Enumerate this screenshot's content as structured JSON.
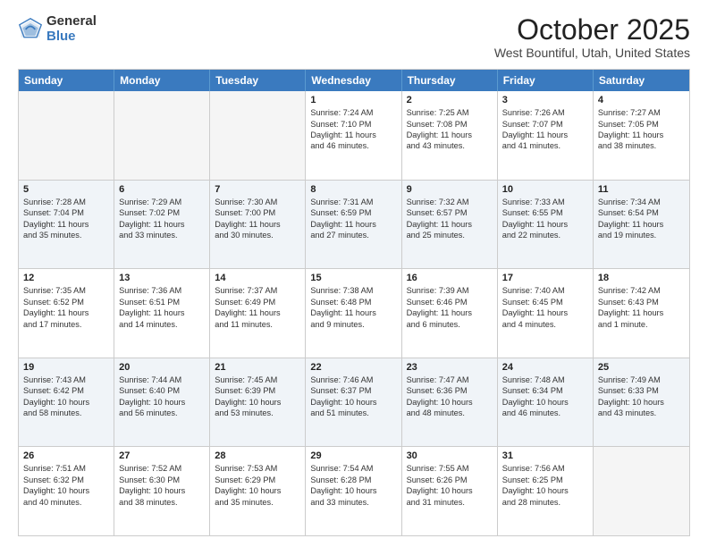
{
  "logo": {
    "general": "General",
    "blue": "Blue"
  },
  "header": {
    "month": "October 2025",
    "location": "West Bountiful, Utah, United States"
  },
  "days_of_week": [
    "Sunday",
    "Monday",
    "Tuesday",
    "Wednesday",
    "Thursday",
    "Friday",
    "Saturday"
  ],
  "weeks": [
    [
      {
        "day": "",
        "info": ""
      },
      {
        "day": "",
        "info": ""
      },
      {
        "day": "",
        "info": ""
      },
      {
        "day": "1",
        "info": "Sunrise: 7:24 AM\nSunset: 7:10 PM\nDaylight: 11 hours\nand 46 minutes."
      },
      {
        "day": "2",
        "info": "Sunrise: 7:25 AM\nSunset: 7:08 PM\nDaylight: 11 hours\nand 43 minutes."
      },
      {
        "day": "3",
        "info": "Sunrise: 7:26 AM\nSunset: 7:07 PM\nDaylight: 11 hours\nand 41 minutes."
      },
      {
        "day": "4",
        "info": "Sunrise: 7:27 AM\nSunset: 7:05 PM\nDaylight: 11 hours\nand 38 minutes."
      }
    ],
    [
      {
        "day": "5",
        "info": "Sunrise: 7:28 AM\nSunset: 7:04 PM\nDaylight: 11 hours\nand 35 minutes."
      },
      {
        "day": "6",
        "info": "Sunrise: 7:29 AM\nSunset: 7:02 PM\nDaylight: 11 hours\nand 33 minutes."
      },
      {
        "day": "7",
        "info": "Sunrise: 7:30 AM\nSunset: 7:00 PM\nDaylight: 11 hours\nand 30 minutes."
      },
      {
        "day": "8",
        "info": "Sunrise: 7:31 AM\nSunset: 6:59 PM\nDaylight: 11 hours\nand 27 minutes."
      },
      {
        "day": "9",
        "info": "Sunrise: 7:32 AM\nSunset: 6:57 PM\nDaylight: 11 hours\nand 25 minutes."
      },
      {
        "day": "10",
        "info": "Sunrise: 7:33 AM\nSunset: 6:55 PM\nDaylight: 11 hours\nand 22 minutes."
      },
      {
        "day": "11",
        "info": "Sunrise: 7:34 AM\nSunset: 6:54 PM\nDaylight: 11 hours\nand 19 minutes."
      }
    ],
    [
      {
        "day": "12",
        "info": "Sunrise: 7:35 AM\nSunset: 6:52 PM\nDaylight: 11 hours\nand 17 minutes."
      },
      {
        "day": "13",
        "info": "Sunrise: 7:36 AM\nSunset: 6:51 PM\nDaylight: 11 hours\nand 14 minutes."
      },
      {
        "day": "14",
        "info": "Sunrise: 7:37 AM\nSunset: 6:49 PM\nDaylight: 11 hours\nand 11 minutes."
      },
      {
        "day": "15",
        "info": "Sunrise: 7:38 AM\nSunset: 6:48 PM\nDaylight: 11 hours\nand 9 minutes."
      },
      {
        "day": "16",
        "info": "Sunrise: 7:39 AM\nSunset: 6:46 PM\nDaylight: 11 hours\nand 6 minutes."
      },
      {
        "day": "17",
        "info": "Sunrise: 7:40 AM\nSunset: 6:45 PM\nDaylight: 11 hours\nand 4 minutes."
      },
      {
        "day": "18",
        "info": "Sunrise: 7:42 AM\nSunset: 6:43 PM\nDaylight: 11 hours\nand 1 minute."
      }
    ],
    [
      {
        "day": "19",
        "info": "Sunrise: 7:43 AM\nSunset: 6:42 PM\nDaylight: 10 hours\nand 58 minutes."
      },
      {
        "day": "20",
        "info": "Sunrise: 7:44 AM\nSunset: 6:40 PM\nDaylight: 10 hours\nand 56 minutes."
      },
      {
        "day": "21",
        "info": "Sunrise: 7:45 AM\nSunset: 6:39 PM\nDaylight: 10 hours\nand 53 minutes."
      },
      {
        "day": "22",
        "info": "Sunrise: 7:46 AM\nSunset: 6:37 PM\nDaylight: 10 hours\nand 51 minutes."
      },
      {
        "day": "23",
        "info": "Sunrise: 7:47 AM\nSunset: 6:36 PM\nDaylight: 10 hours\nand 48 minutes."
      },
      {
        "day": "24",
        "info": "Sunrise: 7:48 AM\nSunset: 6:34 PM\nDaylight: 10 hours\nand 46 minutes."
      },
      {
        "day": "25",
        "info": "Sunrise: 7:49 AM\nSunset: 6:33 PM\nDaylight: 10 hours\nand 43 minutes."
      }
    ],
    [
      {
        "day": "26",
        "info": "Sunrise: 7:51 AM\nSunset: 6:32 PM\nDaylight: 10 hours\nand 40 minutes."
      },
      {
        "day": "27",
        "info": "Sunrise: 7:52 AM\nSunset: 6:30 PM\nDaylight: 10 hours\nand 38 minutes."
      },
      {
        "day": "28",
        "info": "Sunrise: 7:53 AM\nSunset: 6:29 PM\nDaylight: 10 hours\nand 35 minutes."
      },
      {
        "day": "29",
        "info": "Sunrise: 7:54 AM\nSunset: 6:28 PM\nDaylight: 10 hours\nand 33 minutes."
      },
      {
        "day": "30",
        "info": "Sunrise: 7:55 AM\nSunset: 6:26 PM\nDaylight: 10 hours\nand 31 minutes."
      },
      {
        "day": "31",
        "info": "Sunrise: 7:56 AM\nSunset: 6:25 PM\nDaylight: 10 hours\nand 28 minutes."
      },
      {
        "day": "",
        "info": ""
      }
    ]
  ]
}
